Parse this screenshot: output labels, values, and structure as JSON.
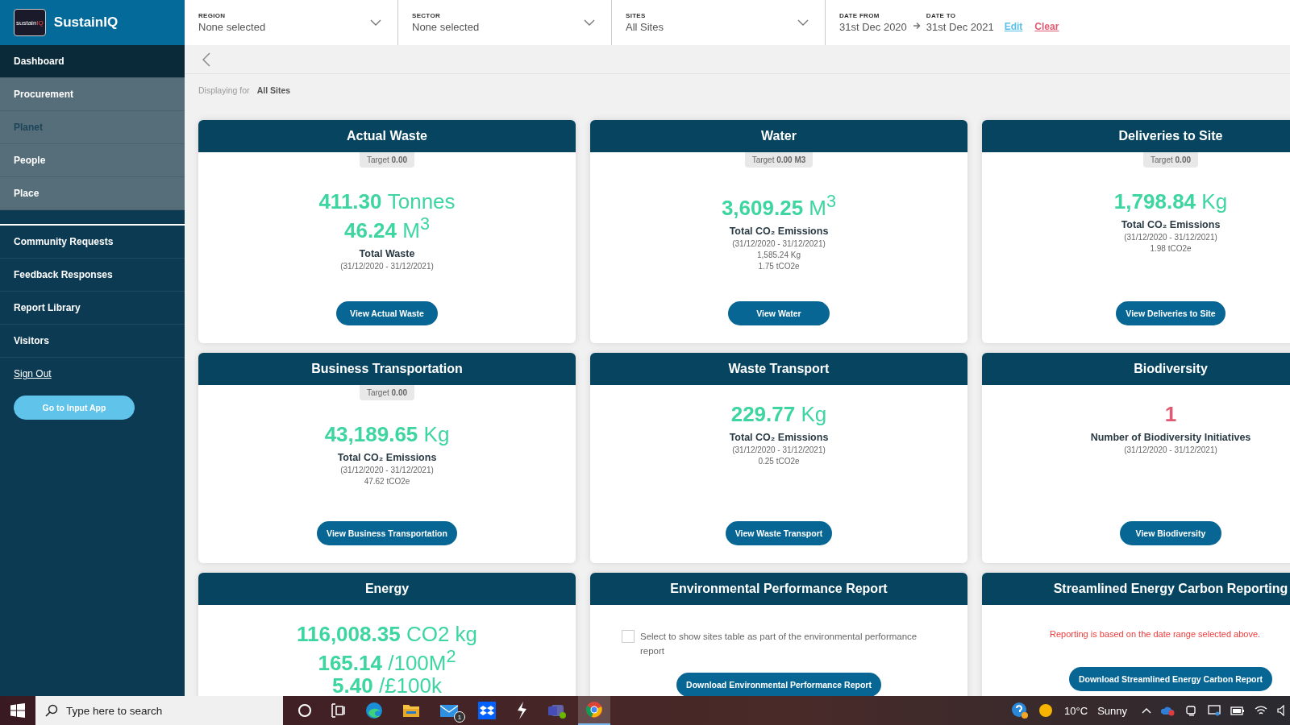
{
  "brand": {
    "name": "SustainIQ",
    "logo_text": "sustain",
    "logo_accent": "IQ"
  },
  "sidebar": {
    "primary": [
      {
        "label": "Dashboard",
        "selected": true,
        "disabled": false
      },
      {
        "label": "Procurement",
        "selected": false,
        "disabled": false
      },
      {
        "label": "Planet",
        "selected": false,
        "disabled": true
      },
      {
        "label": "People",
        "selected": false,
        "disabled": false
      },
      {
        "label": "Place",
        "selected": false,
        "disabled": false
      }
    ],
    "secondary": [
      {
        "label": "Community Requests"
      },
      {
        "label": "Feedback Responses"
      },
      {
        "label": "Report Library"
      },
      {
        "label": "Visitors"
      }
    ],
    "sign_out": "Sign Out",
    "input_app_button": "Go to Input App"
  },
  "filters": [
    {
      "label": "REGION",
      "value": "None selected"
    },
    {
      "label": "SECTOR",
      "value": "None selected"
    },
    {
      "label": "SITES",
      "value": "All Sites"
    }
  ],
  "date_range": {
    "from_label": "DATE FROM",
    "from": "31st Dec 2020",
    "to_label": "DATE TO",
    "to": "31st Dec 2021",
    "edit": "Edit",
    "clear": "Clear"
  },
  "displaying": {
    "label": "Displaying for",
    "value": "All Sites"
  },
  "cards": [
    {
      "kind": "metric",
      "title": "Actual Waste",
      "target": "Target **0.00**",
      "values": [
        {
          "number": "411.30",
          "unit": "Tonnes"
        },
        {
          "number": "46.24",
          "unit": "M$^{3}$"
        }
      ],
      "label": "Total Waste",
      "details": [
        "(31/12/2020 - 31/12/2021)"
      ],
      "button": "View Actual Waste"
    },
    {
      "kind": "metric",
      "title": "Water",
      "target": "Target **0.00 M3**",
      "values": [
        {
          "number": "3,609.25",
          "unit": "M$^{3}$"
        }
      ],
      "label": "Total CO₂ Emissions",
      "details": [
        "(31/12/2020 - 31/12/2021)",
        "1,585.24 Kg",
        "1.75 tCO2e"
      ],
      "button": "View Water"
    },
    {
      "kind": "metric",
      "title": "Deliveries to Site",
      "target": "Target **0.00**",
      "values": [
        {
          "number": "1,798.84",
          "unit": "Kg"
        }
      ],
      "label": "Total CO₂ Emissions",
      "details": [
        "(31/12/2020 - 31/12/2021)",
        "1.98 tCO2e"
      ],
      "button": "View Deliveries to Site"
    },
    {
      "kind": "metric",
      "title": "Business Transportation",
      "target": "Target **0.00**",
      "values": [
        {
          "number": "43,189.65",
          "unit": "Kg"
        }
      ],
      "label": "Total CO₂ Emissions",
      "details": [
        "(31/12/2020 - 31/12/2021)",
        "47.62 tCO2e"
      ],
      "button": "View Business Transportation"
    },
    {
      "kind": "metric",
      "title": "Waste Transport",
      "values": [
        {
          "number": "229.77",
          "unit": "Kg"
        }
      ],
      "label": "Total CO₂ Emissions",
      "details": [
        "(31/12/2020 - 31/12/2021)",
        "0.25 tCO2e"
      ],
      "button": "View Waste Transport"
    },
    {
      "kind": "count",
      "title": "Biodiversity",
      "values": [
        {
          "number": "1"
        }
      ],
      "label": "Number of Biodiversity Initiatives",
      "details": [
        "(31/12/2020 - 31/12/2021)"
      ],
      "button": "View Biodiversity"
    },
    {
      "kind": "metric",
      "title": "Energy",
      "values": [
        {
          "number": "116,008.35",
          "unit": "CO2 kg"
        },
        {
          "number": "165.14",
          "unit": "/100M$^{2}$"
        },
        {
          "number": "5.40",
          "unit": "/£100k"
        }
      ]
    },
    {
      "kind": "checkbox",
      "title": "Environmental Performance Report",
      "option": {
        "text": "Select to show sites table as part of the environmental performance report",
        "checked": false
      },
      "button": "Download Environmental Performance Report"
    },
    {
      "kind": "note",
      "title": "Streamlined Energy Carbon Reporting",
      "note": "Reporting is based on the date range selected above.",
      "button": "Download Streamlined Energy Carbon Report"
    }
  ],
  "taskbar": {
    "search_placeholder": "Type here to search",
    "mail_badge": "1",
    "temperature": "10°C",
    "weather": "Sunny"
  }
}
